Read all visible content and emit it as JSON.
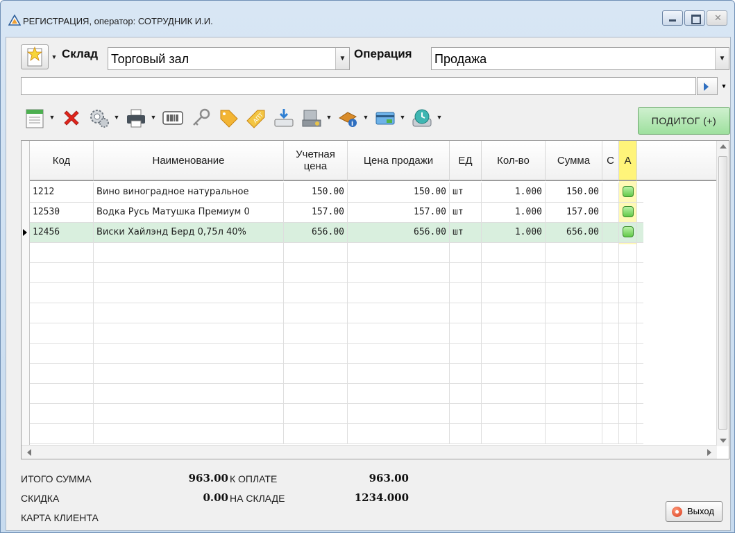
{
  "window": {
    "title": "РЕГИСТРАЦИЯ, оператор: СОТРУДНИК И.И."
  },
  "header": {
    "warehouse_label": "Склад",
    "warehouse_value": "Торговый зал",
    "operation_label": "Операция",
    "operation_value": "Продажа"
  },
  "search": {
    "value": ""
  },
  "toolbar": {
    "subtotal_label": "ПОДИТОГ (+)",
    "icons": [
      "new-document-icon",
      "delete-icon",
      "settings-icon",
      "print-icon",
      "barcode-icon",
      "key-icon",
      "tag-icon",
      "pharmacy-tag-icon",
      "scale-download-icon",
      "cash-register-icon",
      "discount-icon",
      "card-icon",
      "clock-icon"
    ]
  },
  "grid": {
    "columns": [
      {
        "key": "code",
        "label": "Код"
      },
      {
        "key": "name",
        "label": "Наименование"
      },
      {
        "key": "acc_price",
        "label": "Учетная цена"
      },
      {
        "key": "sale_price",
        "label": "Цена продажи"
      },
      {
        "key": "unit",
        "label": "ЕД"
      },
      {
        "key": "qty",
        "label": "Кол-во"
      },
      {
        "key": "sum",
        "label": "Сумма"
      },
      {
        "key": "c",
        "label": "С"
      },
      {
        "key": "a",
        "label": "А"
      }
    ],
    "rows": [
      {
        "code": "1212",
        "name": "Вино виноградное натуральное",
        "acc_price": "150.00",
        "sale_price": "150.00",
        "unit": "шт",
        "qty": "1.000",
        "sum": "150.00",
        "a": true
      },
      {
        "code": "12530",
        "name": "Водка Русь Матушка Премиум 0",
        "acc_price": "157.00",
        "sale_price": "157.00",
        "unit": "шт",
        "qty": "1.000",
        "sum": "157.00",
        "a": true
      },
      {
        "code": "12456",
        "name": "Виски Хайлэнд Берд 0,75л 40%",
        "acc_price": "656.00",
        "sale_price": "656.00",
        "unit": "шт",
        "qty": "1.000",
        "sum": "656.00",
        "a": true
      }
    ],
    "selected_row": 2,
    "highlight_color": "#fff47a",
    "selected_color": "#d9efde"
  },
  "footer": {
    "total_label": "ИТОГО СУММА",
    "total_value": "963.00",
    "to_pay_label": "К ОПЛАТЕ",
    "to_pay_value": "963.00",
    "discount_label": "СКИДКА",
    "discount_value": "0.00",
    "in_stock_label": "НА СКЛАДЕ",
    "in_stock_value": "1234.000",
    "client_card_label": "КАРТА КЛИЕНТА",
    "exit_label": "Выход"
  }
}
